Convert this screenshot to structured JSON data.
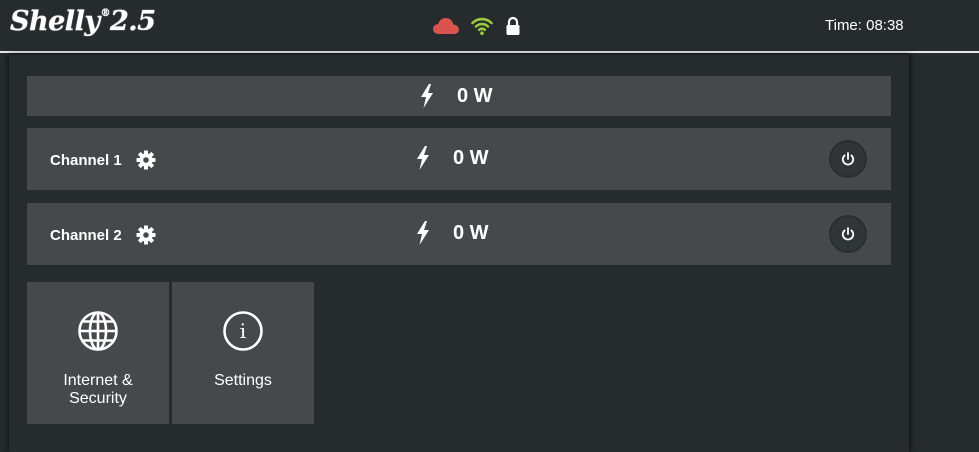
{
  "header": {
    "brand": "Shelly",
    "brand_mark": "®",
    "model": "2.5",
    "time": "Time: 08:38",
    "status_icons": [
      "cloud-icon",
      "wifi-icon",
      "lock-icon"
    ],
    "colors": {
      "cloud": "#d9534f",
      "wifi": "#9ccc3b",
      "lock": "#ffffff"
    }
  },
  "total": {
    "power": "0 W"
  },
  "channels": [
    {
      "label": "Channel 1",
      "power": "0 W"
    },
    {
      "label": "Channel 2",
      "power": "0 W"
    }
  ],
  "tiles": [
    {
      "label": "Internet & Security",
      "icon": "globe-icon"
    },
    {
      "label": "Settings",
      "icon": "info-icon"
    }
  ]
}
